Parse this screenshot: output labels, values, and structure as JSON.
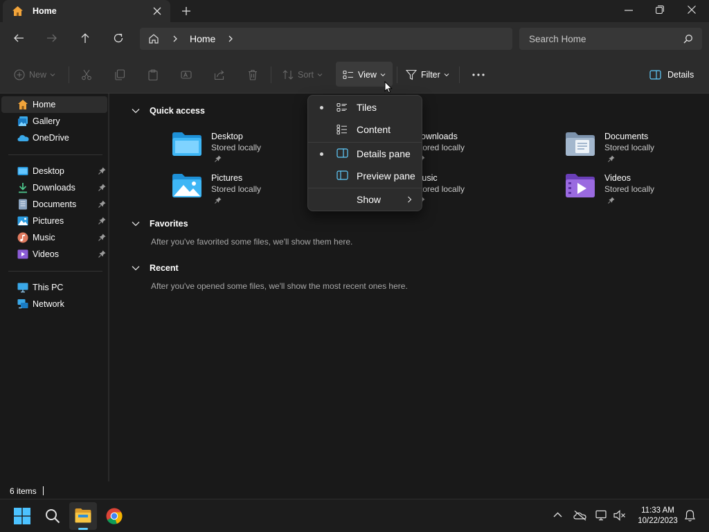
{
  "window": {
    "tab_title": "Home",
    "tab_icon": "home-icon"
  },
  "address_bar": {
    "breadcrumb": [
      "Home"
    ],
    "search_placeholder": "Search Home"
  },
  "command_bar": {
    "new_label": "New",
    "sort_label": "Sort",
    "view_label": "View",
    "filter_label": "Filter",
    "details_label": "Details"
  },
  "sidebar": {
    "top": [
      {
        "label": "Home",
        "icon": "home-icon",
        "selected": true
      },
      {
        "label": "Gallery",
        "icon": "gallery-icon"
      },
      {
        "label": "OneDrive",
        "icon": "onedrive-icon"
      }
    ],
    "pinned": [
      {
        "label": "Desktop",
        "icon": "desktop-folder-icon"
      },
      {
        "label": "Downloads",
        "icon": "downloads-folder-icon"
      },
      {
        "label": "Documents",
        "icon": "documents-folder-icon"
      },
      {
        "label": "Pictures",
        "icon": "pictures-folder-icon"
      },
      {
        "label": "Music",
        "icon": "music-folder-icon"
      },
      {
        "label": "Videos",
        "icon": "videos-folder-icon"
      }
    ],
    "bottom": [
      {
        "label": "This PC",
        "icon": "pc-icon"
      },
      {
        "label": "Network",
        "icon": "network-icon"
      }
    ]
  },
  "main": {
    "quick_access": {
      "title": "Quick access",
      "items": [
        {
          "name": "Desktop",
          "sub": "Stored locally"
        },
        {
          "name": "Downloads",
          "sub": "Stored locally"
        },
        {
          "name": "Documents",
          "sub": "Stored locally"
        },
        {
          "name": "Pictures",
          "sub": "Stored locally"
        },
        {
          "name": "Music",
          "sub": "Stored locally"
        },
        {
          "name": "Videos",
          "sub": "Stored locally"
        }
      ]
    },
    "favorites": {
      "title": "Favorites",
      "message": "After you've favorited some files, we'll show them here."
    },
    "recent": {
      "title": "Recent",
      "message": "After you've opened some files, we'll show the most recent ones here."
    }
  },
  "view_menu": {
    "items": [
      {
        "label": "Tiles",
        "selected": true
      },
      {
        "label": "Content",
        "selected": false
      },
      {
        "label": "Details pane",
        "selected": true
      },
      {
        "label": "Preview pane",
        "selected": false
      },
      {
        "label": "Show",
        "submenu": true
      }
    ]
  },
  "status": {
    "item_count": "6 items"
  },
  "taskbar": {
    "time": "11:33 AM",
    "date": "10/22/2023"
  },
  "colors": {
    "accent": "#60cdff",
    "folder_blue": "#3aa8e8",
    "background": "#191919"
  }
}
